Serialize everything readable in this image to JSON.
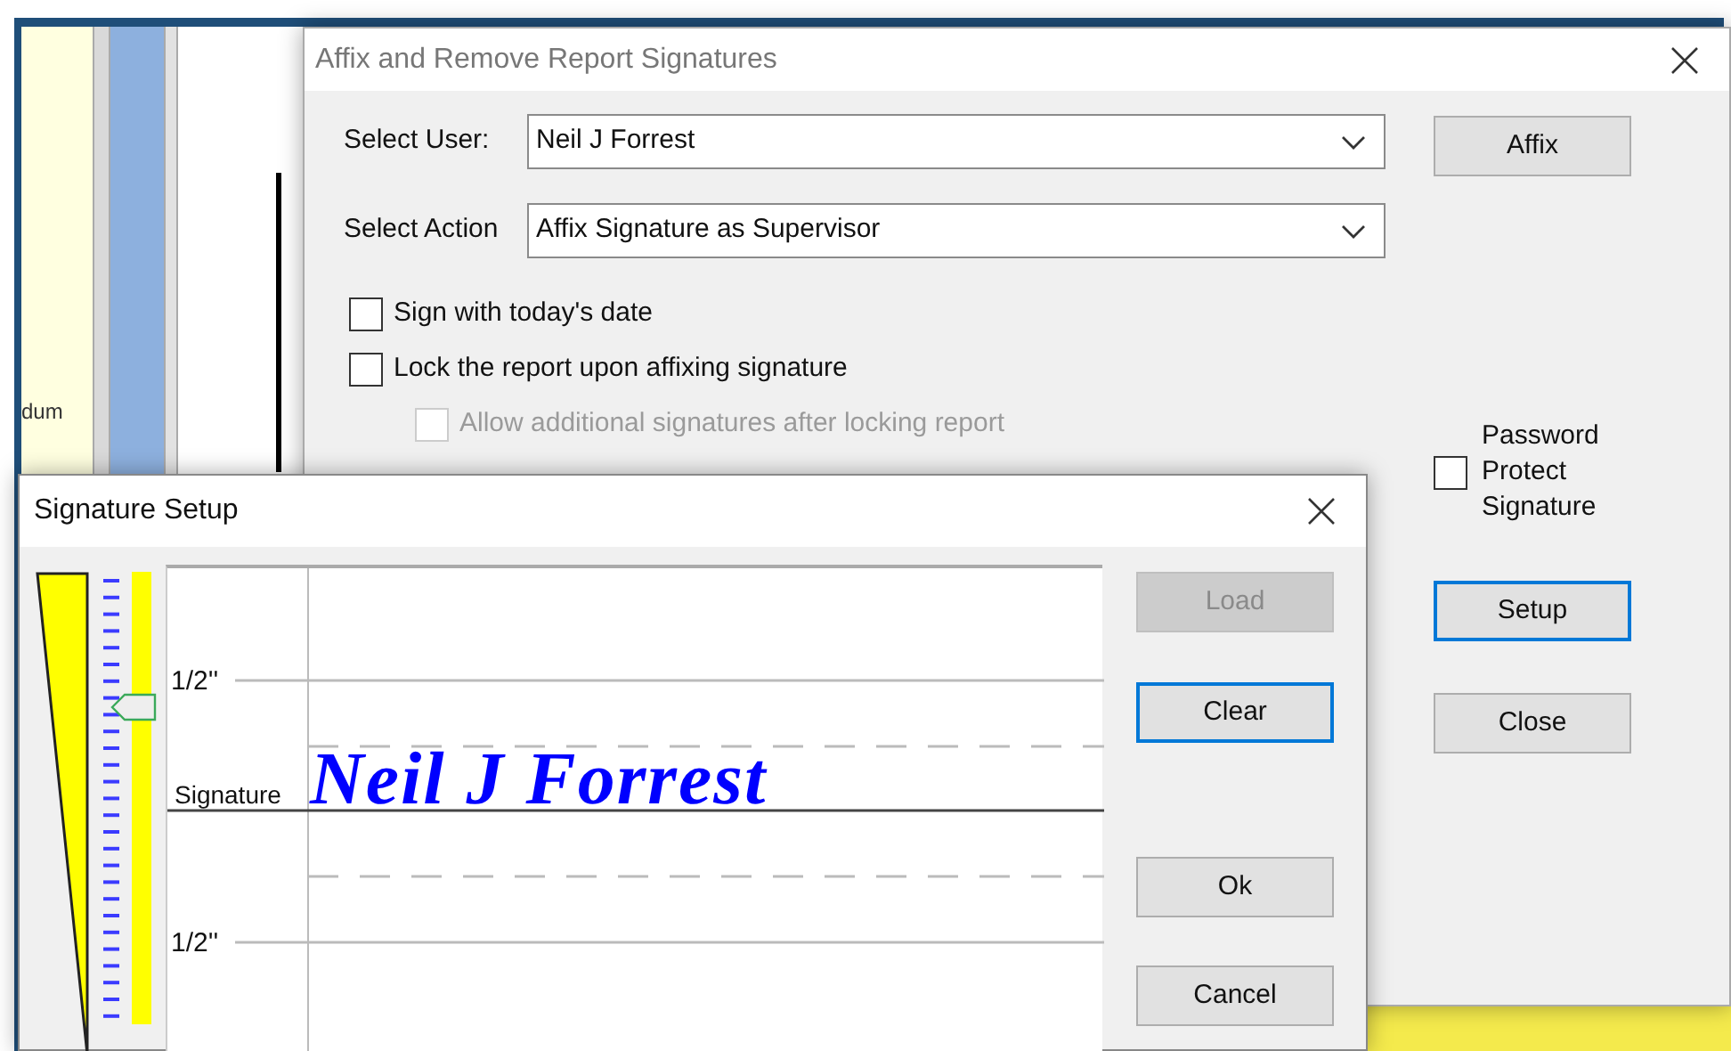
{
  "background_app": {
    "column_text": "dum"
  },
  "main_dialog": {
    "title": "Affix and Remove Report Signatures",
    "fields": [
      {
        "label": "Select User:",
        "value": "Neil J Forrest"
      },
      {
        "label": "Select Action",
        "value": "Affix Signature as Supervisor"
      }
    ],
    "options": [
      {
        "label": "Sign with today's date",
        "checked": false,
        "disabled": false
      },
      {
        "label": "Lock the report upon affixing signature",
        "checked": false,
        "disabled": false,
        "children": [
          {
            "label": "Allow additional signatures after locking report",
            "checked": false,
            "disabled": true
          }
        ]
      }
    ],
    "side_controls": [
      {
        "kind": "button",
        "label": "Affix",
        "focused": false
      },
      {
        "kind": "checkbox",
        "label": "Password Protect Signature",
        "checked": false
      },
      {
        "kind": "button",
        "label": "Setup",
        "focused": true
      },
      {
        "kind": "button",
        "label": "Close",
        "focused": false
      }
    ]
  },
  "signature_setup": {
    "title": "Signature Setup",
    "size_slider": {
      "level": 0.7
    },
    "guides": [
      {
        "label": "1/2''"
      },
      {
        "label": "Signature"
      },
      {
        "label": "1/2''"
      }
    ],
    "signature": "Neil J Forrest",
    "buttons": [
      {
        "label": "Load",
        "disabled": true,
        "focused": false
      },
      {
        "label": "Clear",
        "disabled": false,
        "focused": true
      },
      {
        "label": "Ok",
        "disabled": false,
        "focused": false
      },
      {
        "label": "Cancel",
        "disabled": false,
        "focused": false
      }
    ]
  }
}
